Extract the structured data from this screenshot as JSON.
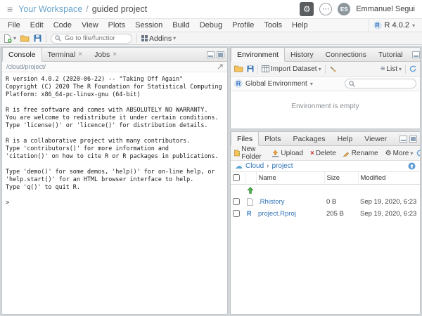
{
  "icons": {
    "menu": "≡",
    "gear": "⚙",
    "more": "⋯",
    "close": "×",
    "caret": "▾",
    "slash": "/",
    "cloud": "☁",
    "breadcrumb_sep": "›",
    "delete": "×",
    "list": "≡"
  },
  "colors": {
    "workspace_link": "#68a3cb",
    "file_link": "#3173b5",
    "r_blue": "#276dc3",
    "up_arrow_green": "#4cae4c",
    "delete_red": "#c9302c"
  },
  "topbar": {
    "workspace": "Your Workspace",
    "project": "guided project",
    "user_initials": "ES",
    "user_name": "Emmanuel Segui"
  },
  "menubar": {
    "items": [
      "File",
      "Edit",
      "Code",
      "View",
      "Plots",
      "Session",
      "Build",
      "Debug",
      "Profile",
      "Tools",
      "Help"
    ],
    "r_version": "R 4.0.2"
  },
  "toolbar": {
    "goto_placeholder": "Go to file/functior",
    "addins_label": "Addins"
  },
  "console": {
    "tabs": [
      "Console",
      "Terminal",
      "Jobs"
    ],
    "active_tab": "Console",
    "path": "/cloud/project/",
    "output": "R version 4.0.2 (2020-06-22) -- \"Taking Off Again\"\nCopyright (C) 2020 The R Foundation for Statistical Computing\nPlatform: x86_64-pc-linux-gnu (64-bit)\n\nR is free software and comes with ABSOLUTELY NO WARRANTY.\nYou are welcome to redistribute it under certain conditions.\nType 'license()' or 'licence()' for distribution details.\n\nR is a collaborative project with many contributors.\nType 'contributors()' for more information and\n'citation()' on how to cite R or R packages in publications.\n\nType 'demo()' for some demos, 'help()' for on-line help, or\n'help.start()' for an HTML browser interface to help.\nType 'q()' to quit R.\n\n> "
  },
  "environment": {
    "tabs": [
      "Environment",
      "History",
      "Connections",
      "Tutorial"
    ],
    "active_tab": "Environment",
    "import_dataset": "Import Dataset",
    "list_label": "List",
    "scope": "Global Environment",
    "empty_message": "Environment is empty"
  },
  "files": {
    "tabs": [
      "Files",
      "Plots",
      "Packages",
      "Help",
      "Viewer"
    ],
    "active_tab": "Files",
    "buttons": {
      "new_folder": "New Folder",
      "upload": "Upload",
      "delete": "Delete",
      "rename": "Rename",
      "more": "More"
    },
    "breadcrumb": {
      "root": "Cloud",
      "current": "project"
    },
    "columns": [
      "Name",
      "Size",
      "Modified"
    ],
    "rows": [
      {
        "icon": "up-arrow",
        "name": "",
        "size": "",
        "modified": ""
      },
      {
        "icon": "file",
        "name": ".Rhistory",
        "size": "0 B",
        "modified": "Sep 19, 2020, 6:23"
      },
      {
        "icon": "rproj",
        "name": "project.Rproj",
        "size": "205 B",
        "modified": "Sep 19, 2020, 6:23"
      }
    ]
  }
}
